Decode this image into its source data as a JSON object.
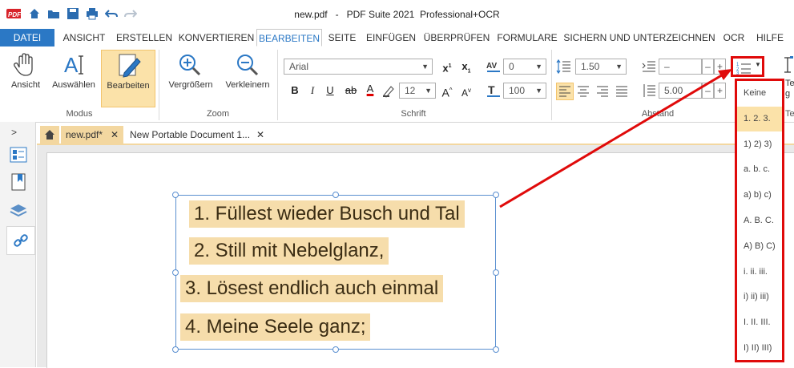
{
  "window": {
    "title": "new.pdf   -   PDF Suite 2021  Professional+OCR"
  },
  "menu": {
    "tabs": [
      "DATEI",
      "ANSICHT",
      "ERSTELLEN",
      "KONVERTIEREN",
      "BEARBEITEN",
      "SEITE",
      "EINFÜGEN",
      "ÜBERPRÜFEN",
      "FORMULARE",
      "SICHERN UND UNTERZEICHNEN",
      "OCR",
      "HILFE"
    ],
    "active": "BEARBEITEN"
  },
  "ribbon": {
    "modus": {
      "label": "Modus",
      "buttons": [
        "Ansicht",
        "Auswählen",
        "Bearbeiten"
      ]
    },
    "zoom": {
      "label": "Zoom",
      "buttons": [
        "Vergrößern",
        "Verkleinern"
      ]
    },
    "schrift": {
      "label": "Schrift",
      "font": "Arial",
      "size": "12",
      "spacing": "0",
      "scale": "100",
      "bold": "B",
      "italic": "I",
      "underline": "U",
      "strike": "ab",
      "color": "A",
      "grow": "A",
      "shrink": "A",
      "superscript": "x",
      "subscript": "x"
    },
    "abstand": {
      "label": "Abstand",
      "line_spacing": "1.50",
      "indent": "–",
      "indent2": "5.00",
      "minus": "–",
      "plus": "+"
    },
    "te_label": "Te",
    "te_label2": "g",
    "te_label3": "Te"
  },
  "doc_tabs": [
    "new.pdf*",
    "New Portable Document 1..."
  ],
  "document": {
    "lines": [
      "1.  Füllest wieder Busch und Tal",
      "2.  Still mit Nebelglanz,",
      "3.  Lösest endlich auch einmal",
      "4.  Meine Seele ganz;"
    ]
  },
  "numbering_dropdown": {
    "items": [
      "Keine",
      "1. 2. 3.",
      "1) 2) 3)",
      "a. b. c.",
      "a) b) c)",
      "A. B. C.",
      "A) B) C)",
      "i. ii. iii.",
      "i) ii) iii)",
      "I. II. III.",
      "I) II) III)"
    ],
    "selected": "1. 2. 3."
  },
  "colors": {
    "accent": "#2b78c5",
    "highlight": "#fbe2a9",
    "annotation": "#e00a0a"
  }
}
